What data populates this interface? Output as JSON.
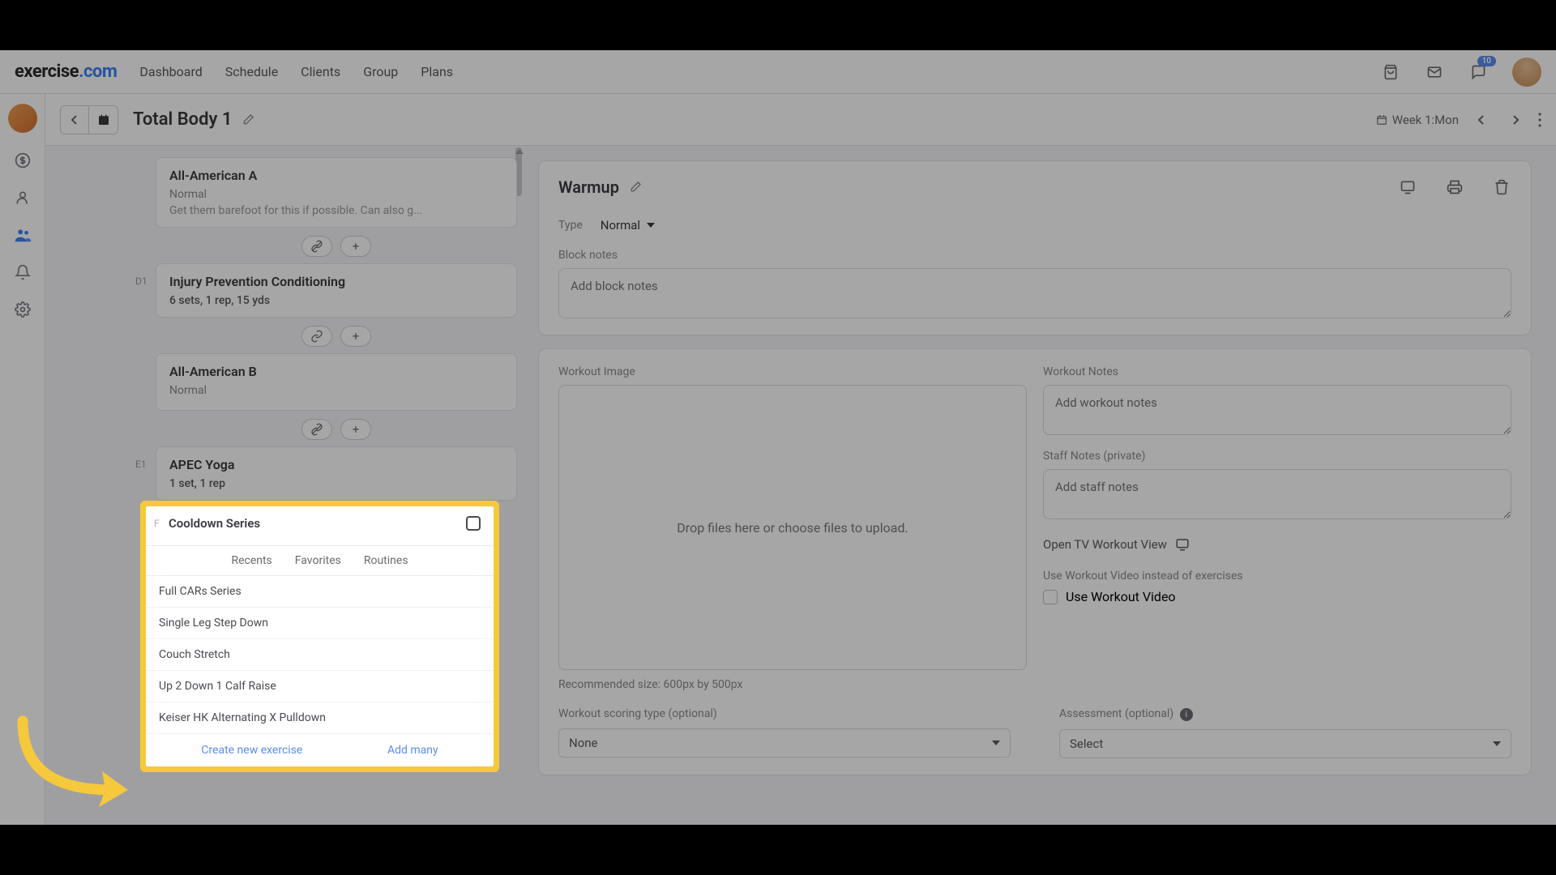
{
  "brand": {
    "name_a": "exercise",
    "name_b": ".com"
  },
  "nav": {
    "dashboard": "Dashboard",
    "schedule": "Schedule",
    "clients": "Clients",
    "group": "Group",
    "plans": "Plans"
  },
  "notif_badge": "10",
  "plan": {
    "title": "Total Body 1",
    "week_label": "Week 1:Mon"
  },
  "exercises": {
    "c1": {
      "title": "All-American A",
      "sub": "Normal",
      "note": "Get them barefoot for this if possible. Can also g..."
    },
    "d1": {
      "tag": "D1",
      "title": "Injury Prevention Conditioning",
      "meta": "6 sets, 1 rep, 15 yds"
    },
    "c2": {
      "title": "All-American B",
      "sub": "Normal"
    },
    "e1": {
      "tag": "E1",
      "title": "APEC Yoga",
      "meta": "1 set, 1 rep"
    }
  },
  "block": {
    "title": "Warmup",
    "type_label": "Type",
    "type_value": "Normal",
    "notes_label": "Block notes",
    "notes_ph": "Add block notes",
    "img_label": "Workout Image",
    "dropzone_text": "Drop files here or choose files to upload.",
    "rec_text": "Recommended size: 600px by 500px",
    "wnotes_label": "Workout Notes",
    "wnotes_ph": "Add workout notes",
    "staff_label": "Staff Notes (private)",
    "staff_ph": "Add staff notes",
    "tv_label": "Open TV Workout View",
    "usevid_label": "Use Workout Video instead of exercises",
    "usevid_check": "Use Workout Video",
    "scoring_label": "Workout scoring type (optional)",
    "scoring_value": "None",
    "assess_label": "Assessment (optional)",
    "assess_value": "Select"
  },
  "popup": {
    "letter": "F",
    "title": "Cooldown Series",
    "tabs": {
      "recents": "Recents",
      "favorites": "Favorites",
      "routines": "Routines"
    },
    "items": [
      "Full CARs Series",
      "Single Leg Step Down",
      "Couch Stretch",
      "Up 2 Down 1 Calf Raise",
      "Keiser HK Alternating X Pulldown"
    ],
    "create": "Create new exercise",
    "add_many": "Add many"
  }
}
